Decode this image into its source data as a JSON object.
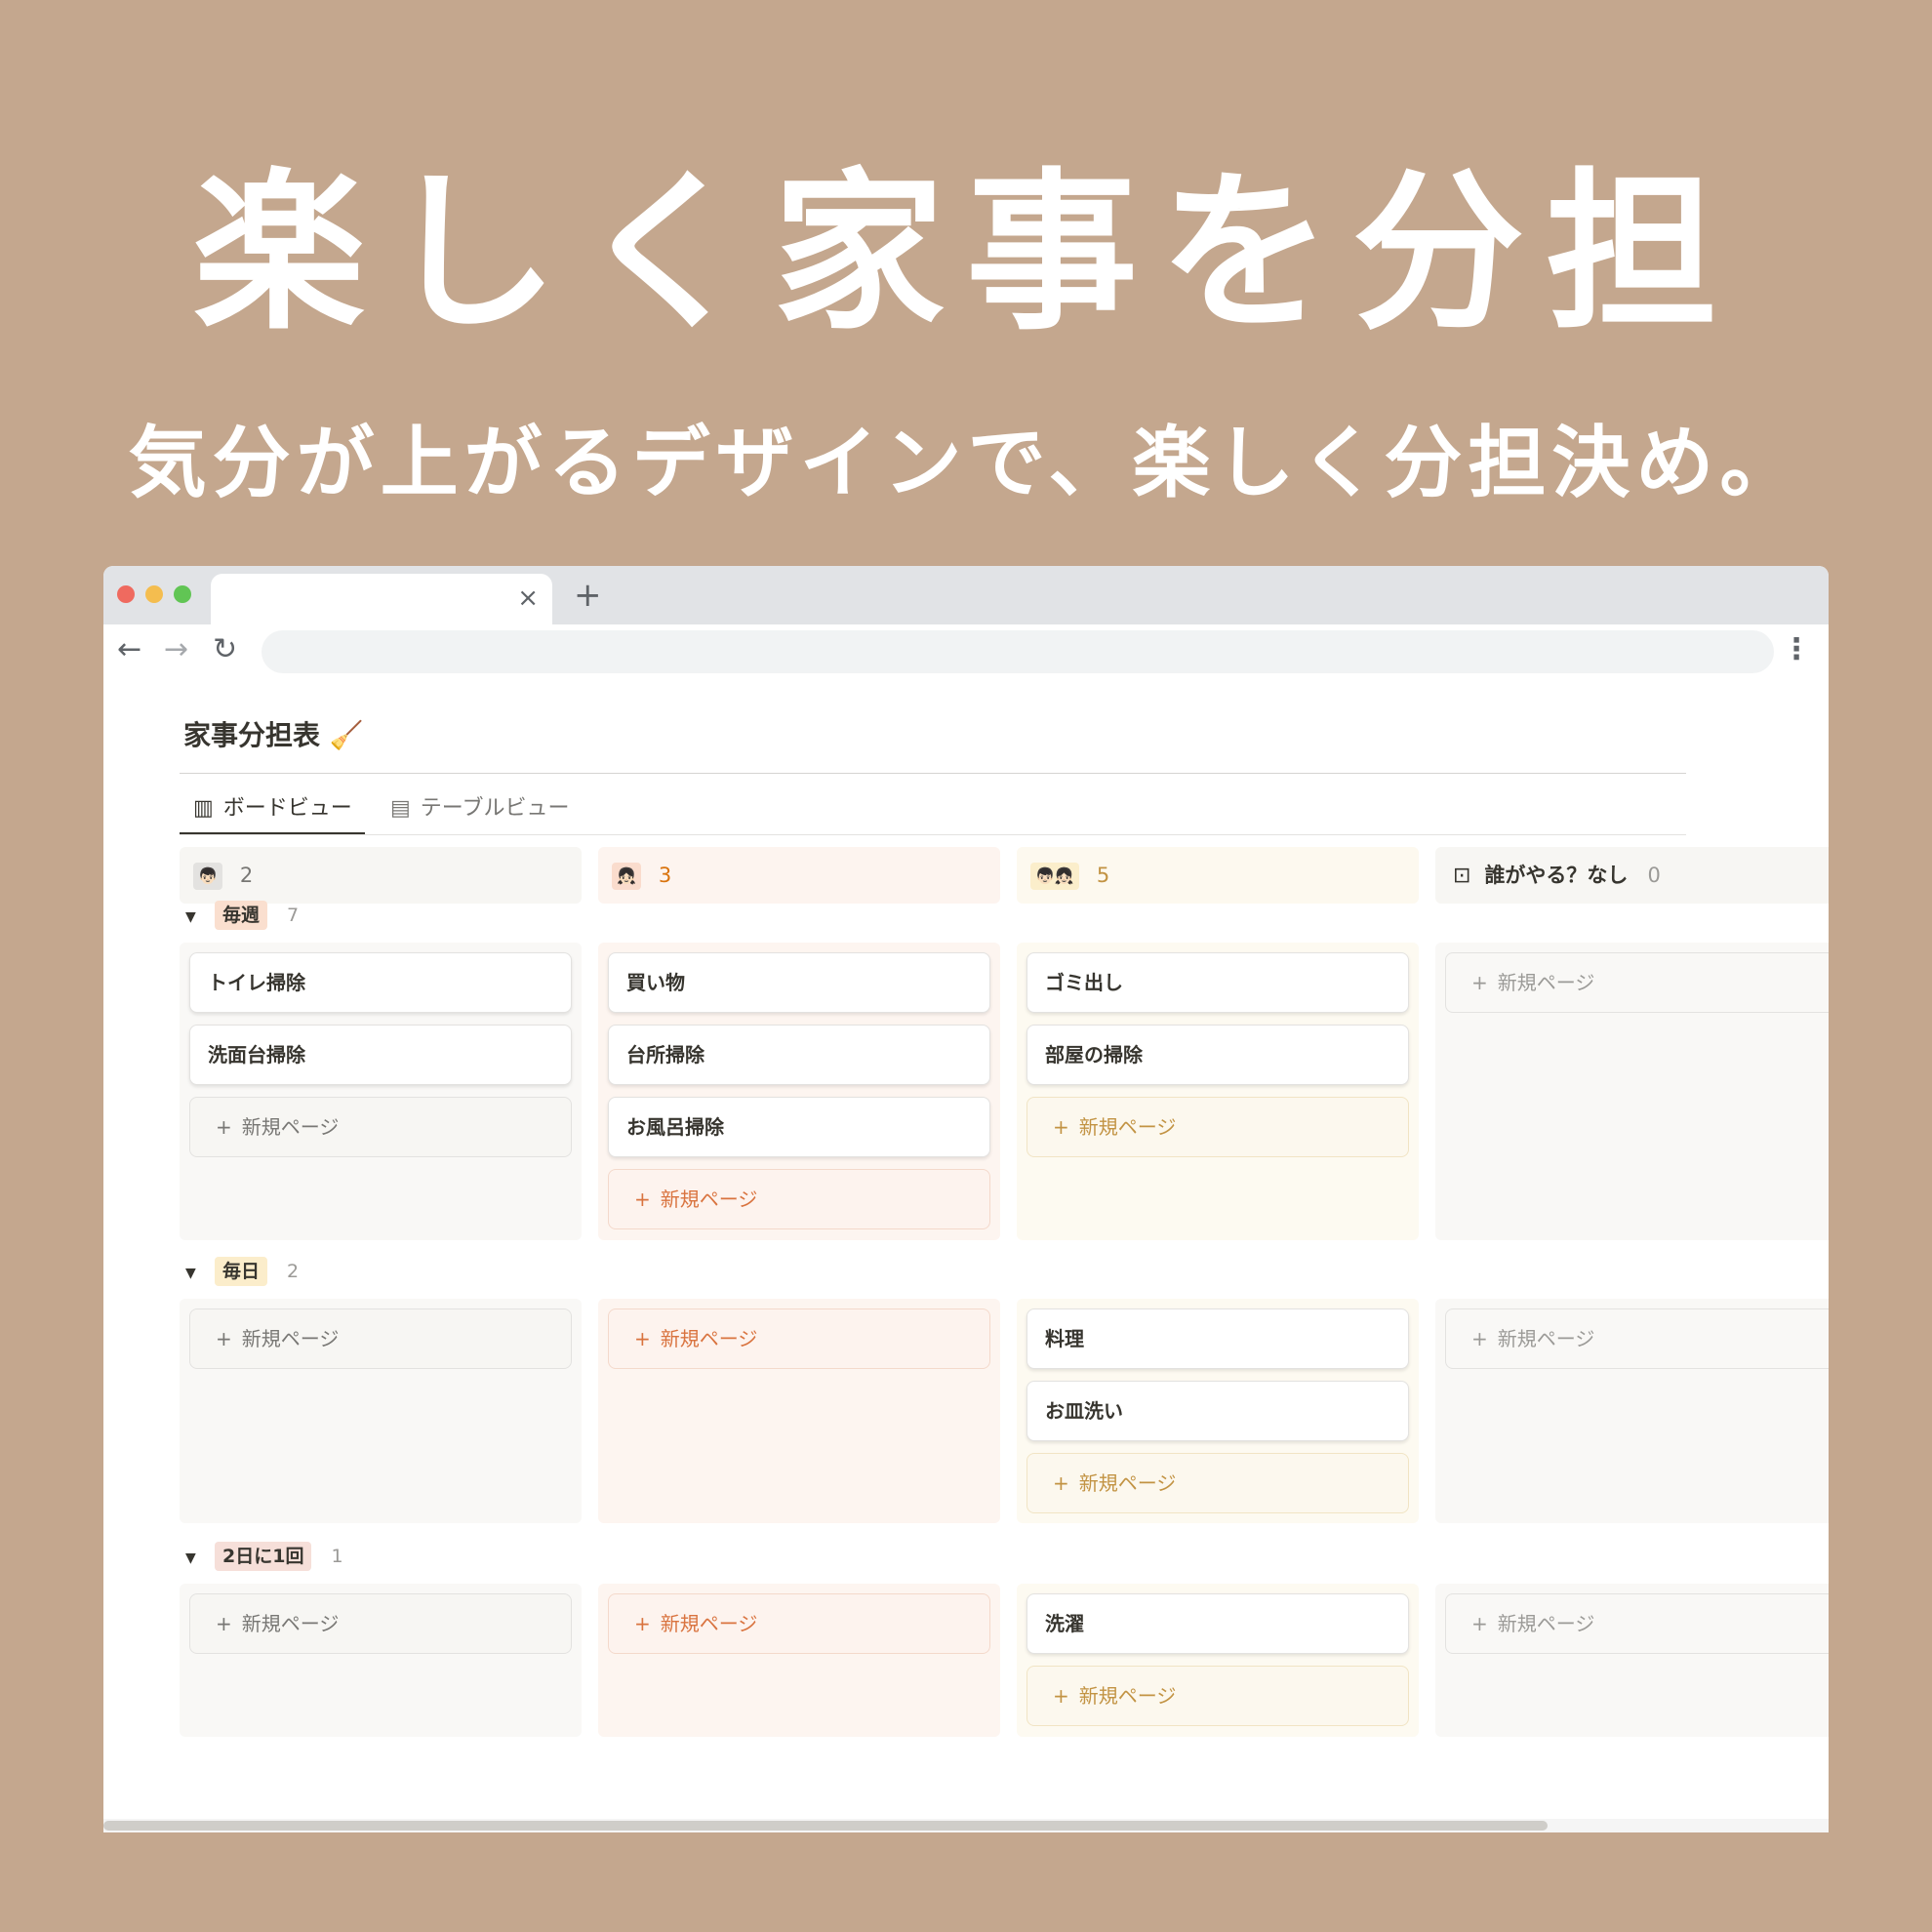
{
  "promo": {
    "headline": "楽しく家事を分担",
    "subline": "気分が上がるデザインで、楽しく分担決め。"
  },
  "browser": {
    "tab_close": "×",
    "new_tab": "+",
    "back": "←",
    "forward": "→",
    "reload": "↻",
    "menu": "⋮",
    "address": ""
  },
  "page": {
    "title": "家事分担表 🧹",
    "views": [
      {
        "label": "ボードビュー",
        "icon": "board-icon",
        "glyph": "▥",
        "active": true
      },
      {
        "label": "テーブルビュー",
        "icon": "table-icon",
        "glyph": "▤",
        "active": false
      }
    ]
  },
  "columns": [
    {
      "avatar": "👦🏻",
      "count": "2",
      "header_bg": "#f7f6f3",
      "chip_bg": "#e3e2e0",
      "count_color": "#787774"
    },
    {
      "avatar": "👧🏻",
      "count": "3",
      "header_bg": "#fdf4ef",
      "chip_bg": "#fadccd",
      "count_color": "#d9730d"
    },
    {
      "avatar": "👦🏻👧🏻",
      "count": "5",
      "header_bg": "#fdf9ef",
      "chip_bg": "#fbeecb",
      "count_color": "#c29343"
    },
    {
      "avatar": "",
      "label": "誰がやる？なし",
      "count": "0",
      "header_bg": "#f7f6f3"
    }
  ],
  "groups": [
    {
      "label": "毎週",
      "count": "7",
      "badge_bg": "#fadfcf",
      "cells": [
        [
          "トイレ掃除",
          "洗面台掃除"
        ],
        [
          "買い物",
          "台所掃除",
          "お風呂掃除"
        ],
        [
          "ゴミ出し",
          "部屋の掃除"
        ],
        []
      ]
    },
    {
      "label": "毎日",
      "count": "2",
      "badge_bg": "#fbedcb",
      "cells": [
        [],
        [],
        [
          "料理",
          "お皿洗い"
        ],
        []
      ]
    },
    {
      "label": "2日に1回",
      "count": "1",
      "badge_bg": "#f6dfd9",
      "cells": [
        [],
        [],
        [
          "洗濯"
        ],
        []
      ]
    }
  ],
  "add_label": "新規ページ",
  "add_plus": "+",
  "colors": {
    "col_bg": [
      "#f9f8f6",
      "#fdf5f0",
      "#fdfaf1",
      "#f9f8f6"
    ],
    "add_text": [
      "#787774",
      "#d9733f",
      "#c29343",
      "#9b9a97"
    ],
    "add_border": [
      "#e3e2e0",
      "#f4d9cb",
      "#f1e4c4",
      "#e3e2e0"
    ],
    "add_bg": [
      "#f7f6f3",
      "#fdf3ee",
      "#fcf8ee",
      "#f9f8f6"
    ]
  }
}
